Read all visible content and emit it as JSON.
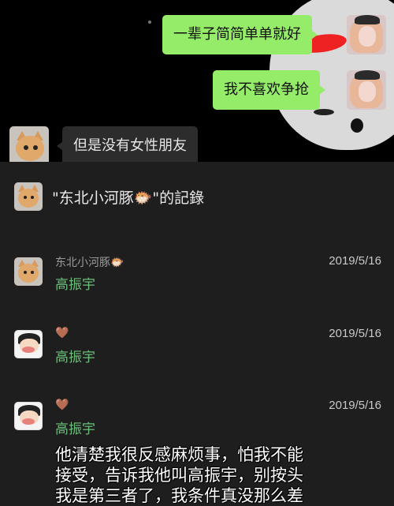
{
  "chat": {
    "messages": [
      {
        "side": "right",
        "text": "一辈子简简单单就好"
      },
      {
        "side": "right",
        "text": "我不喜欢争抢"
      },
      {
        "side": "left",
        "text": "但是没有女性朋友"
      }
    ]
  },
  "record": {
    "title": "\"东北小河豚🐡\"的記錄",
    "entries": [
      {
        "name": "东北小河豚🐡",
        "date": "2019/5/16",
        "content": "高振宇",
        "avatar_icon": "cat-avatar-icon"
      },
      {
        "name": "🤎",
        "date": "2019/5/16",
        "content": "高振宇",
        "avatar_icon": "cartoon-kid-avatar-icon"
      },
      {
        "name": "🤎",
        "date": "2019/5/16",
        "content": "高振宇",
        "avatar_icon": "cartoon-kid-avatar-icon"
      }
    ]
  },
  "subtitle": {
    "lines": [
      "他清楚我很反感麻烦事，怕我不能",
      "接受，告诉我他叫高振宇，别按头",
      "我是第三者了，我条件真没那么差"
    ]
  },
  "colors": {
    "bubble_green": "#95ec69",
    "bubble_dark": "#2c2c2c",
    "sheet_bg": "#1e1e1e",
    "highlight_green": "#6bbf7a"
  }
}
